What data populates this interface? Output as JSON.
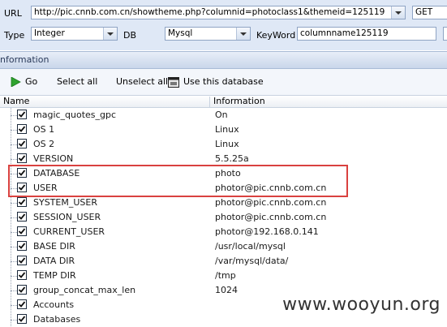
{
  "top": {
    "url_label": "URL",
    "url_value": "http://pic.cnnb.com.cn/showtheme.php?columnid=photoclass1&themeid=125119",
    "method_value": "GET",
    "type_label": "Type",
    "type_value": "Integer",
    "db_label": "DB",
    "db_value": "Mysql",
    "keyword_label": "KeyWord",
    "keyword_value": "columnname125119"
  },
  "section_title": "nformation",
  "toolbar": {
    "go": "Go",
    "select_all": "Select all",
    "unselect_all": "Unselect all",
    "use_db": "Use this database"
  },
  "columns": {
    "name": "Name",
    "info": "Information"
  },
  "rows": [
    {
      "name": "magic_quotes_gpc",
      "info": "On"
    },
    {
      "name": "OS 1",
      "info": "Linux"
    },
    {
      "name": "OS 2",
      "info": "Linux"
    },
    {
      "name": "VERSION",
      "info": "5.5.25a"
    },
    {
      "name": "DATABASE",
      "info": "photo"
    },
    {
      "name": "USER",
      "info": "photor@pic.cnnb.com.cn"
    },
    {
      "name": "SYSTEM_USER",
      "info": "photor@pic.cnnb.com.cn"
    },
    {
      "name": "SESSION_USER",
      "info": "photor@pic.cnnb.com.cn"
    },
    {
      "name": "CURRENT_USER",
      "info": "photor@192.168.0.141"
    },
    {
      "name": "BASE DIR",
      "info": "/usr/local/mysql"
    },
    {
      "name": "DATA DIR",
      "info": "/var/mysql/data/"
    },
    {
      "name": "TEMP DIR",
      "info": "/tmp"
    },
    {
      "name": "group_concat_max_len",
      "info": "1024"
    },
    {
      "name": "Accounts",
      "info": ""
    },
    {
      "name": "Databases",
      "info": ""
    }
  ],
  "watermark": "www.wooyun.org",
  "colors": {
    "highlight": "#d9413f",
    "panel": "#dfe8f6",
    "go_icon": "#2fa32f"
  }
}
